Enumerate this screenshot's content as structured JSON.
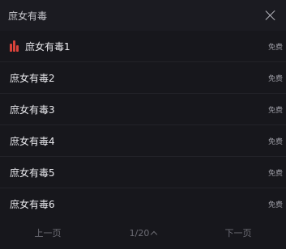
{
  "header": {
    "title": "庶女有毒"
  },
  "episodes": [
    {
      "label": "庶女有毒1",
      "tag": "免费"
    },
    {
      "label": "庶女有毒2",
      "tag": "免费"
    },
    {
      "label": "庶女有毒3",
      "tag": "免费"
    },
    {
      "label": "庶女有毒4",
      "tag": "免费"
    },
    {
      "label": "庶女有毒5",
      "tag": "免费"
    },
    {
      "label": "庶女有毒6",
      "tag": "免费"
    }
  ],
  "pager": {
    "prev": "上一页",
    "page": "1/20",
    "next": "下一页"
  }
}
